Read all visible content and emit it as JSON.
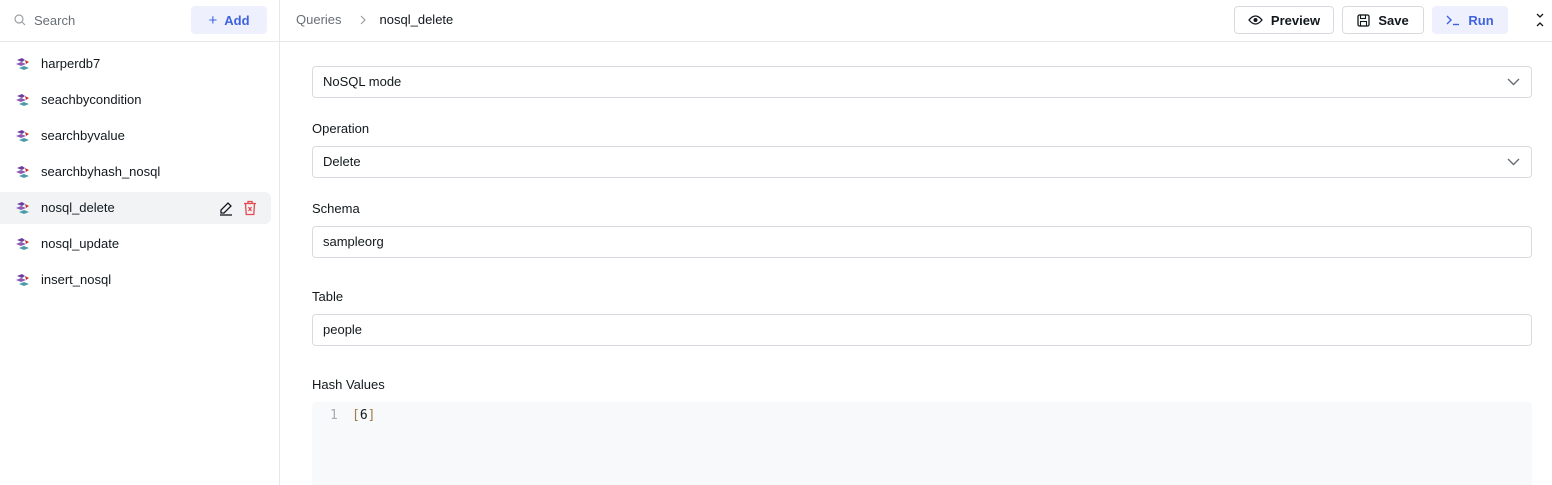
{
  "sidebar": {
    "search": {
      "placeholder": "Search"
    },
    "add_label": "Add",
    "queries": [
      {
        "label": "harperdb7"
      },
      {
        "label": "seachbycondition"
      },
      {
        "label": "searchbyvalue"
      },
      {
        "label": "searchbyhash_nosql"
      },
      {
        "label": "nosql_delete",
        "active": true
      },
      {
        "label": "nosql_update"
      },
      {
        "label": "insert_nosql"
      }
    ]
  },
  "header": {
    "breadcrumb_root": "Queries",
    "breadcrumb_current": "nosql_delete",
    "preview_label": "Preview",
    "save_label": "Save",
    "run_label": "Run"
  },
  "form": {
    "mode": {
      "value": "NoSQL mode"
    },
    "operation": {
      "label": "Operation",
      "value": "Delete"
    },
    "schema": {
      "label": "Schema",
      "value": "sampleorg"
    },
    "table": {
      "label": "Table",
      "value": "people"
    },
    "hash_values": {
      "label": "Hash Values",
      "line_number": "1",
      "open": "[",
      "content": "6",
      "close": "]"
    }
  },
  "colors": {
    "accent": "#3e63dd",
    "accent_bg": "#eef1fd",
    "delete": "#e5484d",
    "active_row": "#f1f3f5"
  },
  "icons": [
    "search-icon",
    "plus-icon",
    "harperdb-icon",
    "edit-icon",
    "trash-icon",
    "chevron-right-icon",
    "eye-icon",
    "save-icon",
    "terminal-icon",
    "collapse-icon",
    "chevron-down-icon"
  ]
}
